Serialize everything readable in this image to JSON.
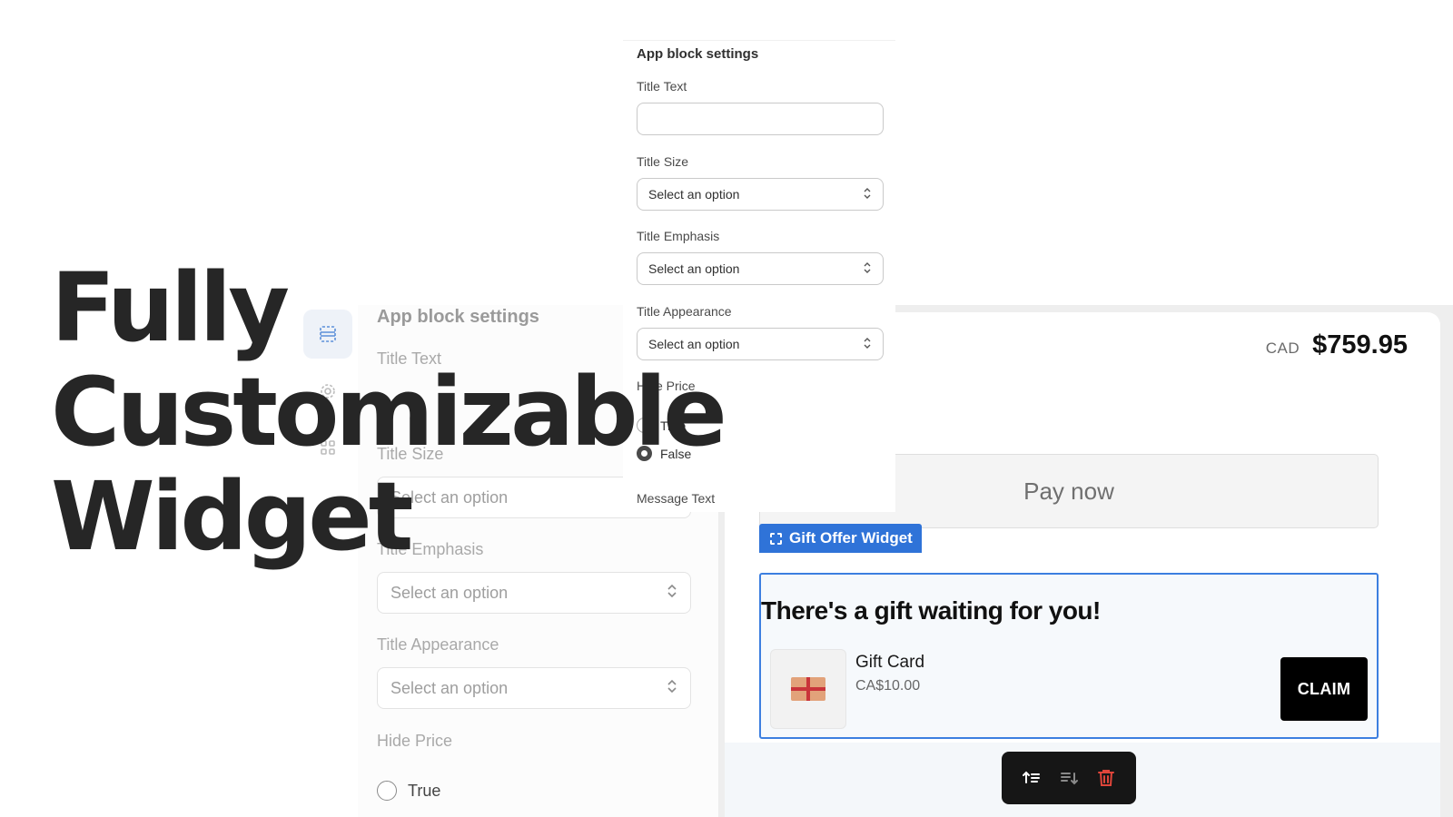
{
  "hero": {
    "lines": [
      "Fully",
      "Customizable",
      "Widget"
    ]
  },
  "settings_panel_front": {
    "heading": "App block settings",
    "title_text_label": "Title Text",
    "title_text_value": "",
    "title_size_label": "Title Size",
    "title_size_value": "Select an option",
    "title_emphasis_label": "Title Emphasis",
    "title_emphasis_value": "Select an option",
    "title_appearance_label": "Title Appearance",
    "title_appearance_value": "Select an option",
    "hide_price_label": "Hide Price",
    "hide_price_options": [
      "True",
      "False"
    ],
    "hide_price_selected": "False",
    "message_text_label": "Message Text"
  },
  "settings_panel_back": {
    "heading": "App block settings",
    "title_text_label": "Title Text",
    "title_size_label": "Title Size",
    "title_size_value": "Select an option",
    "title_emphasis_label": "Title Emphasis",
    "title_emphasis_value": "Select an option",
    "title_appearance_label": "Title Appearance",
    "title_appearance_value": "Select an option",
    "hide_price_label": "Hide Price",
    "hide_price_option_true": "True"
  },
  "checkout": {
    "currency": "CAD",
    "total": "$759.95",
    "pay_button": "Pay now"
  },
  "widget": {
    "tag_label": "Gift Offer Widget",
    "heading": "There's a gift waiting for you!",
    "product_name": "Gift Card",
    "product_price": "CA$10.00",
    "claim_button": "CLAIM"
  },
  "colors": {
    "accent_blue": "#2f73d8",
    "claim_button_bg": "#000000",
    "delete_icon": "#e0453a"
  },
  "icons": {
    "toolbar": [
      "move-up-icon",
      "move-down-icon",
      "delete-icon"
    ],
    "sidebar": [
      "section-icon",
      "settings-icon",
      "apps-icon"
    ]
  }
}
